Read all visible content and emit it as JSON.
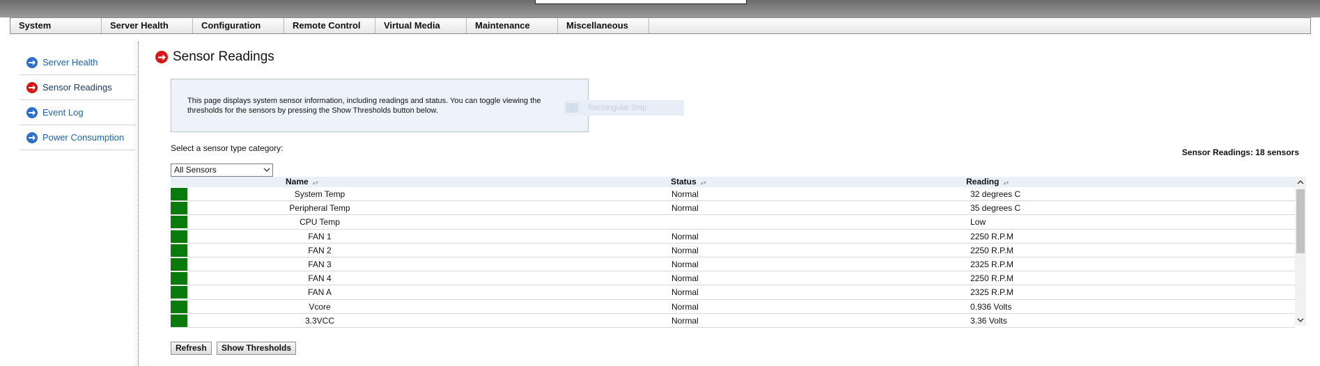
{
  "nav": {
    "items": [
      "System",
      "Server Health",
      "Configuration",
      "Remote Control",
      "Virtual Media",
      "Maintenance",
      "Miscellaneous"
    ]
  },
  "sidebar": {
    "items": [
      {
        "label": "Server Health",
        "icon": "arrow-right-circle-blue-icon"
      },
      {
        "label": "Sensor Readings",
        "icon": "arrow-right-circle-red-icon",
        "active": true
      },
      {
        "label": "Event Log",
        "icon": "arrow-right-circle-blue-icon"
      },
      {
        "label": "Power Consumption",
        "icon": "arrow-right-circle-blue-icon"
      }
    ]
  },
  "page": {
    "title": "Sensor Readings",
    "info_text": "This page displays system sensor information, including readings and status. You can toggle viewing the thresholds for the sensors by pressing the Show Thresholds button below.",
    "ghost_label": "Rectangular Snip",
    "select_label": "Select a sensor type category:",
    "sensor_count": "Sensor Readings: 18 sensors",
    "select_value": "All Sensors"
  },
  "table": {
    "headers": {
      "name": "Name",
      "status": "Status",
      "reading": "Reading"
    },
    "rows": [
      {
        "name": "System Temp",
        "status": "Normal",
        "reading": "32 degrees C"
      },
      {
        "name": "Peripheral Temp",
        "status": "Normal",
        "reading": "35 degrees C"
      },
      {
        "name": "CPU Temp",
        "status": "",
        "reading": "Low"
      },
      {
        "name": "FAN 1",
        "status": "Normal",
        "reading": "2250 R.P.M"
      },
      {
        "name": "FAN 2",
        "status": "Normal",
        "reading": "2250 R.P.M"
      },
      {
        "name": "FAN 3",
        "status": "Normal",
        "reading": "2325 R.P.M"
      },
      {
        "name": "FAN 4",
        "status": "Normal",
        "reading": "2250 R.P.M"
      },
      {
        "name": "FAN A",
        "status": "Normal",
        "reading": "2325 R.P.M"
      },
      {
        "name": "Vcore",
        "status": "Normal",
        "reading": "0.936 Volts"
      },
      {
        "name": "3.3VCC",
        "status": "Normal",
        "reading": "3.36 Volts"
      }
    ],
    "indicator_color": "#0a7a0a"
  },
  "buttons": {
    "refresh": "Refresh",
    "show_thresholds": "Show Thresholds"
  }
}
